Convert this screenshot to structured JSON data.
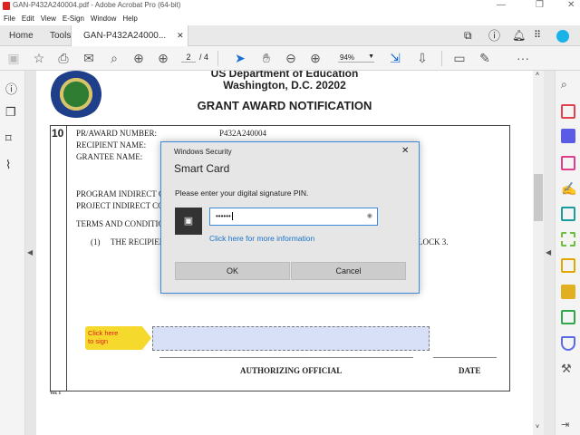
{
  "window": {
    "title": "GAN-P432A240004.pdf - Adobe Acrobat Pro (64-bit)"
  },
  "menu": [
    "File",
    "Edit",
    "View",
    "E-Sign",
    "Window",
    "Help"
  ],
  "tabs": {
    "home": "Home",
    "tools": "Tools",
    "document": "GAN-P432A24000..."
  },
  "toolbar": {
    "page_current": "2",
    "page_total": "/ 4",
    "zoom": "94%"
  },
  "document": {
    "header1": "US Department of Education",
    "header2": "Washington, D.C. 20202",
    "title": "GRANT AWARD NOTIFICATION",
    "block_number": "10",
    "pr_award_label": "PR/AWARD NUMBER:",
    "pr_award_value": "P432A240004",
    "recipient_label": "RECIPIENT NAME:",
    "grantee_label": "GRANTEE NAME:",
    "program_indirect": "PROGRAM INDIRECT C",
    "project_indirect": "PROJECT INDIRECT CO",
    "terms": "TERMS AND CONDITIO",
    "term1_num": "(1)",
    "term1_text": "THE RECIPIEN",
    "term1_end": "LOCK 3.",
    "sign_tag": "Click here to sign",
    "authorizing": "AUTHORIZING OFFICIAL",
    "date": "DATE",
    "version": "Ver. 1"
  },
  "dialog": {
    "caption": "Windows Security",
    "title": "Smart Card",
    "prompt": "Please enter your digital signature PIN.",
    "pin_value": "••••••",
    "link": "Click here for more information",
    "ok": "OK",
    "cancel": "Cancel"
  },
  "colors": {
    "accent": "#3b8bd8",
    "sign_tag": "#f5d92c",
    "sign_field": "#d8e0f7"
  }
}
